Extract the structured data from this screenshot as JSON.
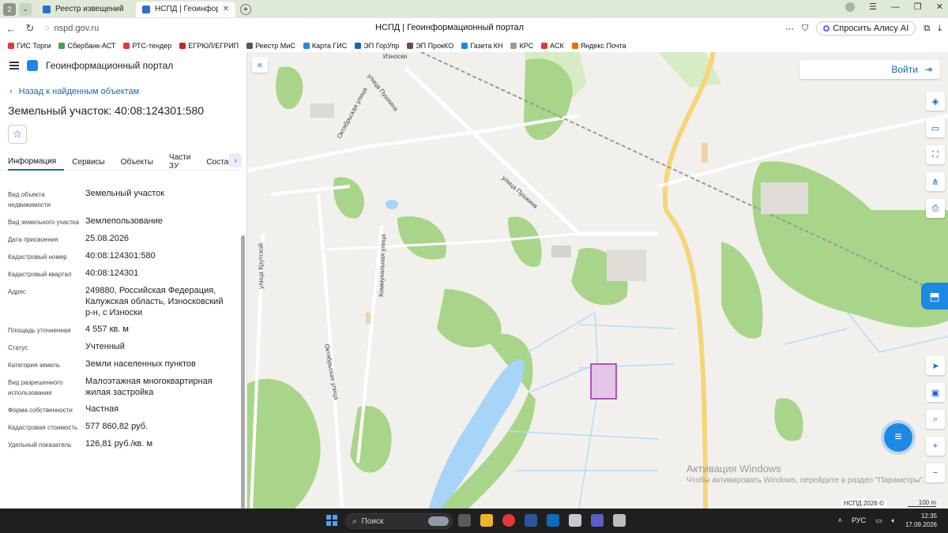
{
  "browser": {
    "tabs": [
      {
        "label": "Реестр извещений",
        "active": false
      },
      {
        "label": "НСПД | Геоинформаци",
        "active": true
      }
    ],
    "url": "nspd.gov.ru",
    "page_title": "НСПД | Геоинформационный портал",
    "alice_label": "Спросить Алису AI",
    "bookmarks": [
      "ГИС Торги",
      "Сбербанк-АСТ",
      "РТС-тендер",
      "ЕГРЮЛ/ЕГРИП",
      "Реестр МиС",
      "Карта ГИС",
      "ЭП ГорУпр",
      "ЭП ПрокКО",
      "Газета КН",
      "КРС",
      "АСК",
      "Яндекс Почта"
    ]
  },
  "app": {
    "title": "Геоинформационный портал",
    "back_label": "Назад к найденным объектам",
    "object_title": "Земельный участок: 40:08:124301:580",
    "tabs": [
      "Информация",
      "Сервисы",
      "Объекты",
      "Части ЗУ",
      "Состав"
    ],
    "properties": [
      {
        "key": "Вид объекта недвижимости",
        "value": "Земельный участок"
      },
      {
        "key": "Вид земельного участка",
        "value": "Землепользование"
      },
      {
        "key": "Дата присвоения",
        "value": "25.08.2026"
      },
      {
        "key": "Кадастровый номер",
        "value": "40:08:124301:580"
      },
      {
        "key": "Кадастровый квартал",
        "value": "40:08:124301"
      },
      {
        "key": "Адрес",
        "value": "249880, Российская Федерация, Калужская область, Износковский р-н, с Износки"
      },
      {
        "key": "Площадь уточненная",
        "value": "4 557 кв. м"
      },
      {
        "key": "Статус",
        "value": "Учтенный"
      },
      {
        "key": "Категория земель",
        "value": "Земли населенных пунктов"
      },
      {
        "key": "Вид разрешенного использования",
        "value": "Малоэтажная многоквартирная жилая застройка"
      },
      {
        "key": "Форма собственности",
        "value": "Частная"
      },
      {
        "key": "Кадастровая стоимость",
        "value": "577 860,82 руб."
      },
      {
        "key": "Удельный показатель",
        "value": "126,81 руб./кв. м"
      }
    ]
  },
  "map": {
    "login_label": "Войти",
    "street_labels": [
      "Октябрьская улица",
      "улица Пушкина",
      "Износки",
      "улица Пушкина",
      "улица Крупской",
      "Коммунальная улица",
      "Октябрьская улица"
    ],
    "watermark_line1": "Активация Windows",
    "watermark_line2": "Чтобы активировать Windows, перейдите в раздел \"Параметры\".",
    "attribution": "НСПД 2026 ©",
    "scale_label": "100 m"
  },
  "taskbar": {
    "search_placeholder": "Поиск",
    "lang": "РУС",
    "time": "12:35",
    "date": "17.09.2026"
  }
}
